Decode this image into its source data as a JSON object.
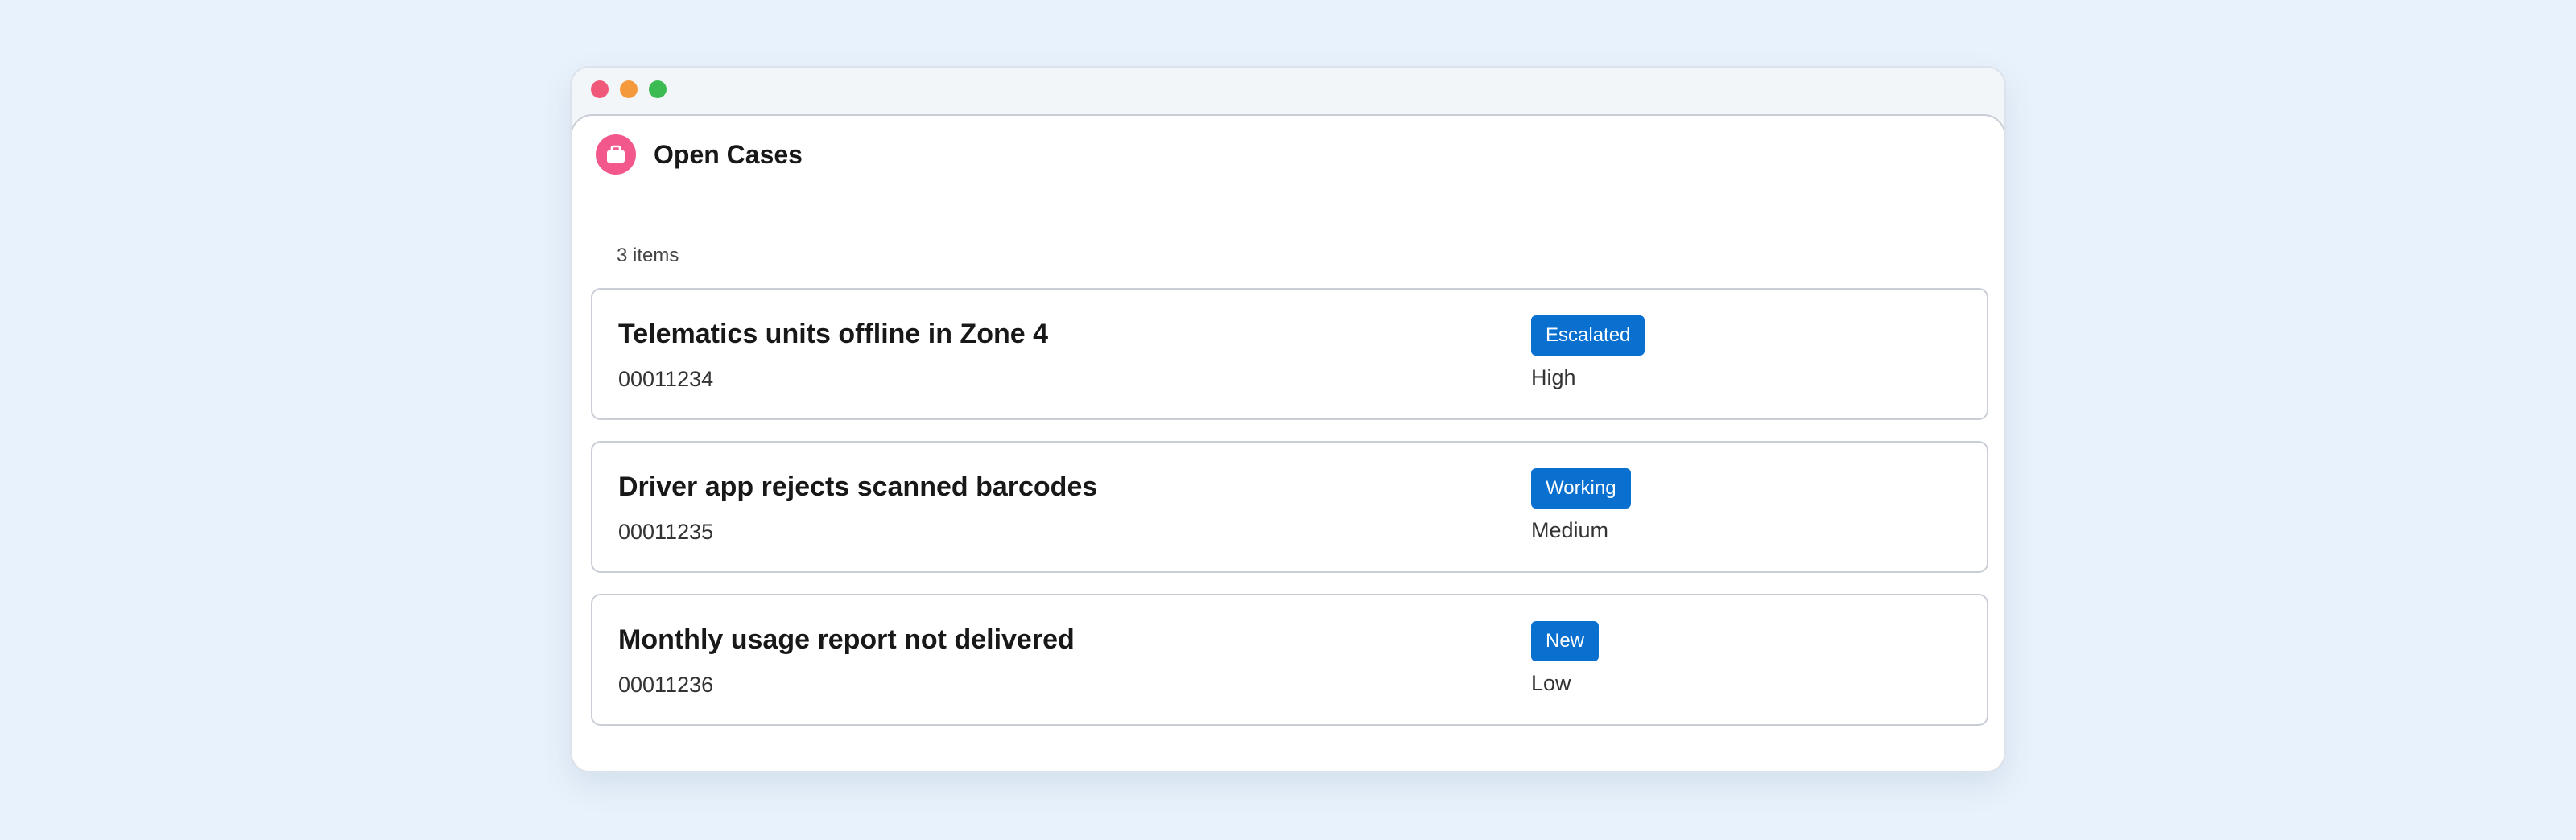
{
  "card": {
    "title": "Open Cases",
    "icon": "briefcase-icon",
    "icon_color": "#f2588b",
    "item_count": "3 items"
  },
  "colors": {
    "badge": "#0a70d0",
    "window_close": "#f0587a",
    "window_minimize": "#f59a3c",
    "window_maximize": "#3dbb53"
  },
  "cases": [
    {
      "subject": "Telematics units offline in Zone 4",
      "number": "00011234",
      "status": "Escalated",
      "priority": "High"
    },
    {
      "subject": "Driver app rejects scanned barcodes",
      "number": "00011235",
      "status": "Working",
      "priority": "Medium"
    },
    {
      "subject": "Monthly usage report not delivered",
      "number": "00011236",
      "status": "New",
      "priority": "Low"
    }
  ]
}
